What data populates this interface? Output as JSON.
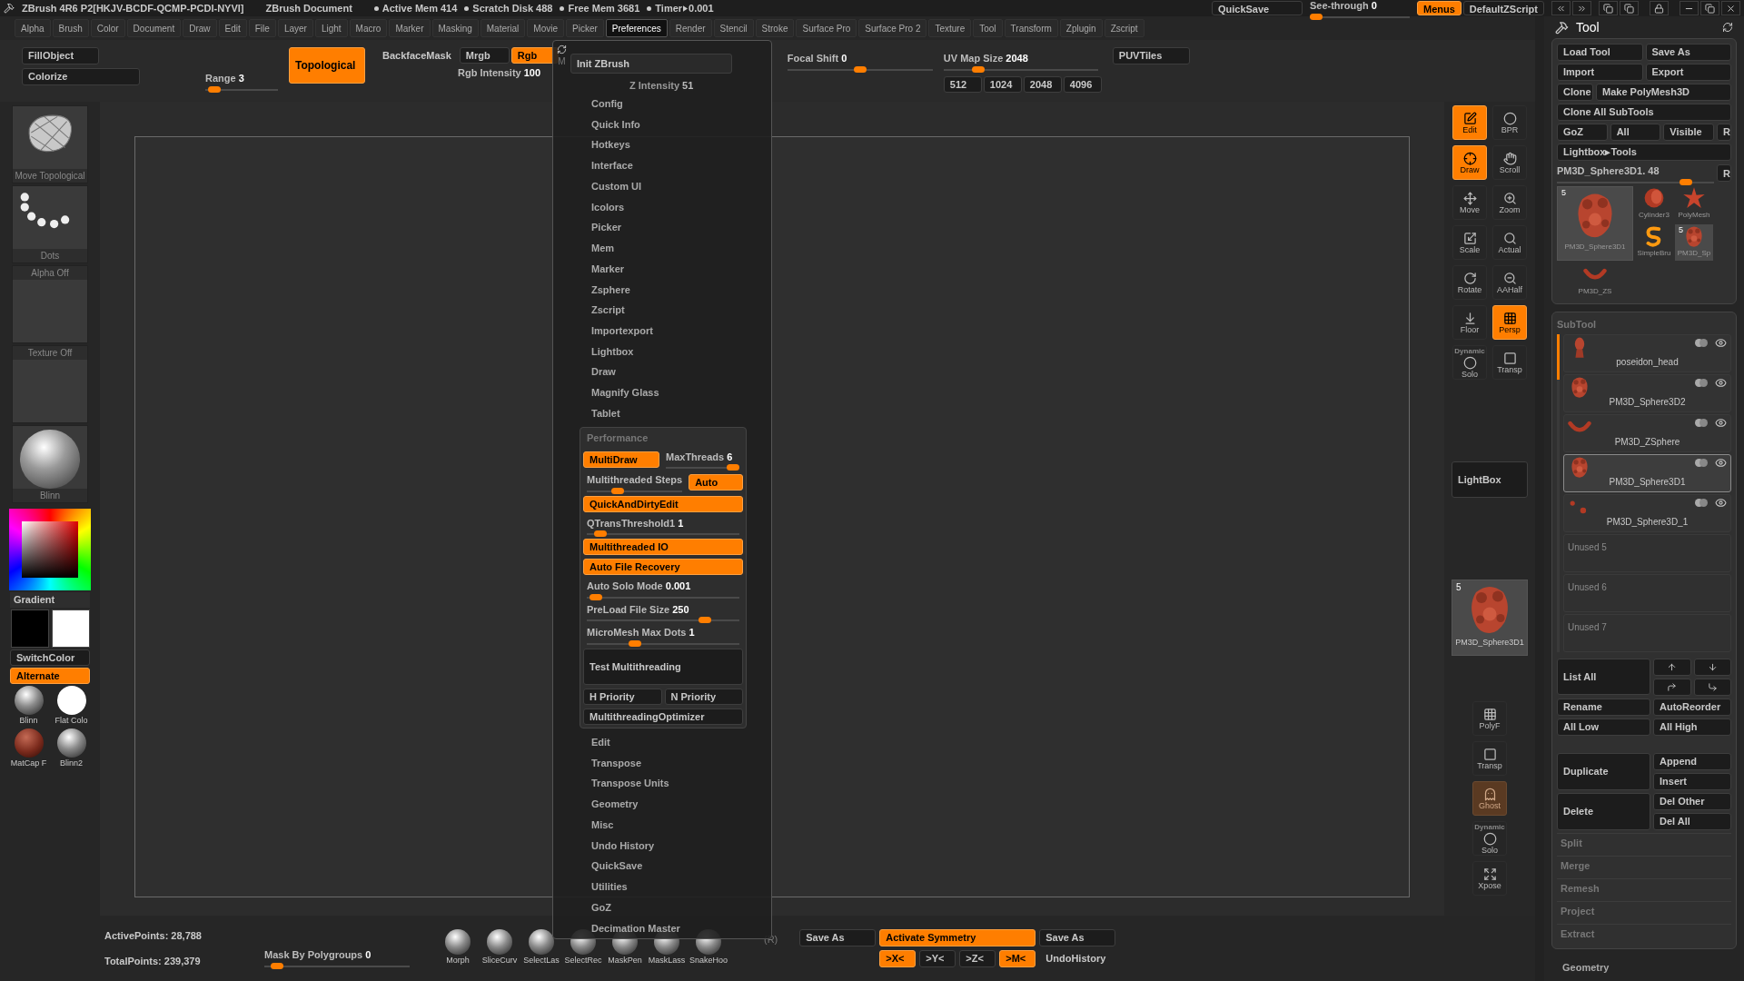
{
  "title_bar": {
    "app": "ZBrush 4R6 P2[HKJV-BCDF-QCMP-PCDI-NYVI]",
    "document": "ZBrush Document",
    "stats": [
      "Active Mem 414",
      "Scratch Disk 488",
      "Free Mem 3681"
    ],
    "timer": {
      "label": "Timer",
      "value": "0.001"
    }
  },
  "top_right": {
    "quicksave": "QuickSave",
    "see_through": {
      "label": "See-through",
      "value": "0",
      "level": 0
    },
    "menus": {
      "label": "Menus",
      "selected": true
    },
    "script": "DefaultZScript"
  },
  "menu_bar": [
    {
      "label": "Alpha",
      "selected": false
    },
    {
      "label": "Brush",
      "selected": false
    },
    {
      "label": "Color",
      "selected": false
    },
    {
      "label": "Document",
      "selected": false
    },
    {
      "label": "Draw",
      "selected": false
    },
    {
      "label": "Edit",
      "selected": false
    },
    {
      "label": "File",
      "selected": false
    },
    {
      "label": "Layer",
      "selected": false
    },
    {
      "label": "Light",
      "selected": false
    },
    {
      "label": "Macro",
      "selected": false
    },
    {
      "label": "Marker",
      "selected": false
    },
    {
      "label": "Masking",
      "selected": false
    },
    {
      "label": "Material",
      "selected": false
    },
    {
      "label": "Movie",
      "selected": false
    },
    {
      "label": "Picker",
      "selected": false
    },
    {
      "label": "Preferences",
      "selected": true
    },
    {
      "label": "Render",
      "selected": false
    },
    {
      "label": "Stencil",
      "selected": false
    },
    {
      "label": "Stroke",
      "selected": false
    },
    {
      "label": "Surface Pro",
      "selected": false
    },
    {
      "label": "Surface Pro 2",
      "selected": false
    },
    {
      "label": "Texture",
      "selected": false
    },
    {
      "label": "Tool",
      "selected": false
    },
    {
      "label": "Transform",
      "selected": false
    },
    {
      "label": "Zplugin",
      "selected": false
    },
    {
      "label": "Zscript",
      "selected": false
    }
  ],
  "top_shelf": {
    "fill_object": "FillObject",
    "colorize": "Colorize",
    "range": {
      "label": "Range",
      "value": "3",
      "level": 0.05
    },
    "topological": {
      "label": "Topological",
      "on": true
    },
    "backface_mask": {
      "label": "BackfaceMask",
      "on": false
    },
    "mrgb": {
      "label": "Mrgb",
      "on": false
    },
    "rgb": {
      "label": "Rgb",
      "on": true
    },
    "rgb_intensity": {
      "label": "Rgb Intensity",
      "value": "100"
    },
    "z_intensity": {
      "label": "Z Intensity",
      "value": "51"
    },
    "focal_shift": {
      "label": "Focal Shift",
      "value": "0",
      "level": 0.5
    },
    "uv_map_size": {
      "label": "UV Map Size",
      "value": "2048",
      "level": 0.2
    },
    "puvtiles": "PUVTiles",
    "sizes": [
      "512",
      "1024",
      "2048",
      "4096"
    ]
  },
  "left_shelf": {
    "tiles": [
      {
        "kind": "brush",
        "label": "Move Topological"
      },
      {
        "kind": "stroke",
        "label": "Dots"
      },
      {
        "kind": "alpha",
        "label": "Alpha Off"
      },
      {
        "kind": "texture",
        "label": "Texture Off"
      },
      {
        "kind": "material",
        "label": "Blinn"
      }
    ],
    "gradient": "Gradient",
    "switch_color": "SwitchColor",
    "alternate": {
      "label": "Alternate",
      "on": true
    },
    "materials": [
      {
        "kind": "shaded",
        "label": "Blinn"
      },
      {
        "kind": "flat",
        "label": "Flat Colo"
      },
      {
        "kind": "matcap",
        "label": "MatCap F"
      },
      {
        "kind": "shaded",
        "label": "Blinn2"
      }
    ]
  },
  "right_tools": {
    "top": [
      {
        "label": "Edit",
        "on": true
      },
      {
        "label": "BPR",
        "on": false
      },
      {
        "label": "Draw",
        "on": true
      },
      {
        "label": "Scroll",
        "on": false
      },
      {
        "label": "Move",
        "on": false
      },
      {
        "label": "Zoom",
        "on": false
      },
      {
        "label": "Scale",
        "on": false
      },
      {
        "label": "Actual",
        "on": false
      },
      {
        "label": "Rotate",
        "on": false
      },
      {
        "label": "AAHalf",
        "on": false
      },
      {
        "label": "Floor",
        "on": false
      },
      {
        "label": "Persp",
        "on": true
      },
      {
        "label": "Solo",
        "caption": "Dynamic",
        "on": false
      },
      {
        "label": "Transp",
        "on": false
      }
    ],
    "lightbox": "LightBox",
    "current_tool": {
      "badge": "5",
      "label": "PM3D_Sphere3D1"
    },
    "bottom": [
      {
        "label": "PolyF",
        "disabled": false
      },
      {
        "label": "Transp",
        "disabled": false
      },
      {
        "label": "Ghost",
        "disabled": true
      },
      {
        "label": "Solo",
        "caption": "Dynamic",
        "disabled": false
      },
      {
        "label": "Xpose",
        "disabled": false
      }
    ]
  },
  "tool_panel": {
    "title": "Tool",
    "rows": [
      [
        "Load Tool",
        "Save As"
      ],
      [
        "Import",
        "Export"
      ],
      [
        "Clone",
        "Make PolyMesh3D"
      ],
      [
        "Clone All SubTools"
      ],
      [
        "GoZ",
        "All",
        "Visible",
        "R"
      ],
      [
        "Lightbox▸Tools"
      ]
    ],
    "slider": {
      "label": "PM3D_Sphere3D1. 48",
      "level": 0.85
    },
    "slider_button": "R",
    "thumbs": [
      {
        "kind": "head",
        "label": "PM3D_Sphere3D1",
        "badge": "5"
      },
      {
        "kind": "cylinder",
        "label": "Cylinder3"
      },
      {
        "kind": "star",
        "label": "PolyMesh"
      },
      {
        "kind": "swirl",
        "label": "SimpleBru"
      },
      {
        "kind": "head",
        "label": "PM3D_Sp",
        "badge": "5"
      },
      {
        "kind": "curve",
        "label": "PM3D_ZS"
      }
    ]
  },
  "subtool": {
    "title": "SubTool",
    "items": [
      {
        "kind": "bust",
        "name": "poseidon_head",
        "selected": false
      },
      {
        "kind": "head",
        "name": "PM3D_Sphere3D2",
        "selected": false
      },
      {
        "kind": "curve",
        "name": "PM3D_ZSphere",
        "selected": false
      },
      {
        "kind": "head",
        "name": "PM3D_Sphere3D1",
        "selected": true
      },
      {
        "kind": "dots",
        "name": "PM3D_Sphere3D_1",
        "selected": false
      }
    ],
    "unused": [
      "Unused 5",
      "Unused 6",
      "Unused 7"
    ],
    "list_all": "List All",
    "rename": "Rename",
    "auto_reorder": "AutoReorder",
    "all_low": "All Low",
    "all_high": "All High",
    "duplicate": "Duplicate",
    "append": "Append",
    "insert": "Insert",
    "delete": "Delete",
    "del_other": "Del Other",
    "del_all": "Del All"
  },
  "sections": [
    "Split",
    "Merge",
    "Remesh",
    "Project",
    "Extract"
  ],
  "geometry": "Geometry",
  "bottom_shelf": {
    "active_points": "ActivePoints: 28,788",
    "total_points": "TotalPoints: 239,379",
    "mask_by_polygroups": {
      "label": "Mask By Polygroups",
      "value": "0",
      "level": 0.05
    },
    "brushes": [
      "Morph",
      "SliceCurv",
      "SelectLas",
      "SelectRec",
      "MaskPen",
      "MaskLass",
      "SnakeHoo"
    ],
    "radial": "(R)",
    "save_as": "Save As",
    "activate_symmetry": {
      "label": "Activate Symmetry",
      "on": true
    },
    "save_as_2": "Save As",
    "axes": [
      {
        "label": ">X<",
        "on": true
      },
      {
        "label": ">Y<",
        "on": false
      },
      {
        "label": ">Z<",
        "on": false
      },
      {
        "label": ">M<",
        "on": true
      }
    ],
    "undo_history": "UndoHistory"
  },
  "preferences_menu": {
    "init": "Init ZBrush",
    "mark": "M",
    "items_before": [
      "Config",
      "Quick Info",
      "Hotkeys",
      "Interface",
      "Custom UI",
      "Icolors",
      "Picker",
      "Mem",
      "Marker",
      "Zsphere",
      "Zscript",
      "Importexport",
      "Lightbox",
      "Draw",
      "Magnify Glass",
      "Tablet"
    ],
    "performance": {
      "title": "Performance",
      "rows": [
        [
          {
            "kind": "toggle",
            "label": "MultiDraw",
            "on": true
          },
          {
            "kind": "slider",
            "label": "MaxThreads",
            "value": "6",
            "level": 1
          }
        ],
        [
          {
            "kind": "slider",
            "label": "Multithreaded Steps",
            "level": 0.3
          },
          {
            "kind": "toggle",
            "label": "Auto",
            "on": true
          }
        ],
        [
          {
            "kind": "toggle",
            "label": "QuickAndDirtyEdit",
            "on": true
          }
        ],
        [
          {
            "kind": "slider",
            "label": "QTransThreshold1",
            "value": "1",
            "level": 0.05
          }
        ],
        [
          {
            "kind": "toggle",
            "label": "Multithreaded IO",
            "on": true
          }
        ],
        [
          {
            "kind": "toggle",
            "label": "Auto File Recovery",
            "on": true
          }
        ],
        [
          {
            "kind": "slider",
            "label": "Auto Solo Mode",
            "value": "0.001",
            "level": 0.02
          }
        ],
        [
          {
            "kind": "slider",
            "label": "PreLoad File Size",
            "value": "250",
            "level": 0.8
          }
        ],
        [
          {
            "kind": "slider",
            "label": "MicroMesh Max Dots",
            "value": "1",
            "level": 0.3
          }
        ],
        [
          {
            "kind": "big_button",
            "label": "Test Multithreading"
          }
        ],
        [
          {
            "kind": "button",
            "label": "H Priority"
          },
          {
            "kind": "button",
            "label": "N Priority"
          }
        ],
        [
          {
            "kind": "button",
            "label": "MultithreadingOptimizer"
          }
        ]
      ]
    },
    "items_after": [
      "Edit",
      "Transpose",
      "Transpose Units",
      "Geometry",
      "Misc",
      "Undo History",
      "QuickSave",
      "Utilities",
      "GoZ",
      "Decimation Master"
    ]
  }
}
